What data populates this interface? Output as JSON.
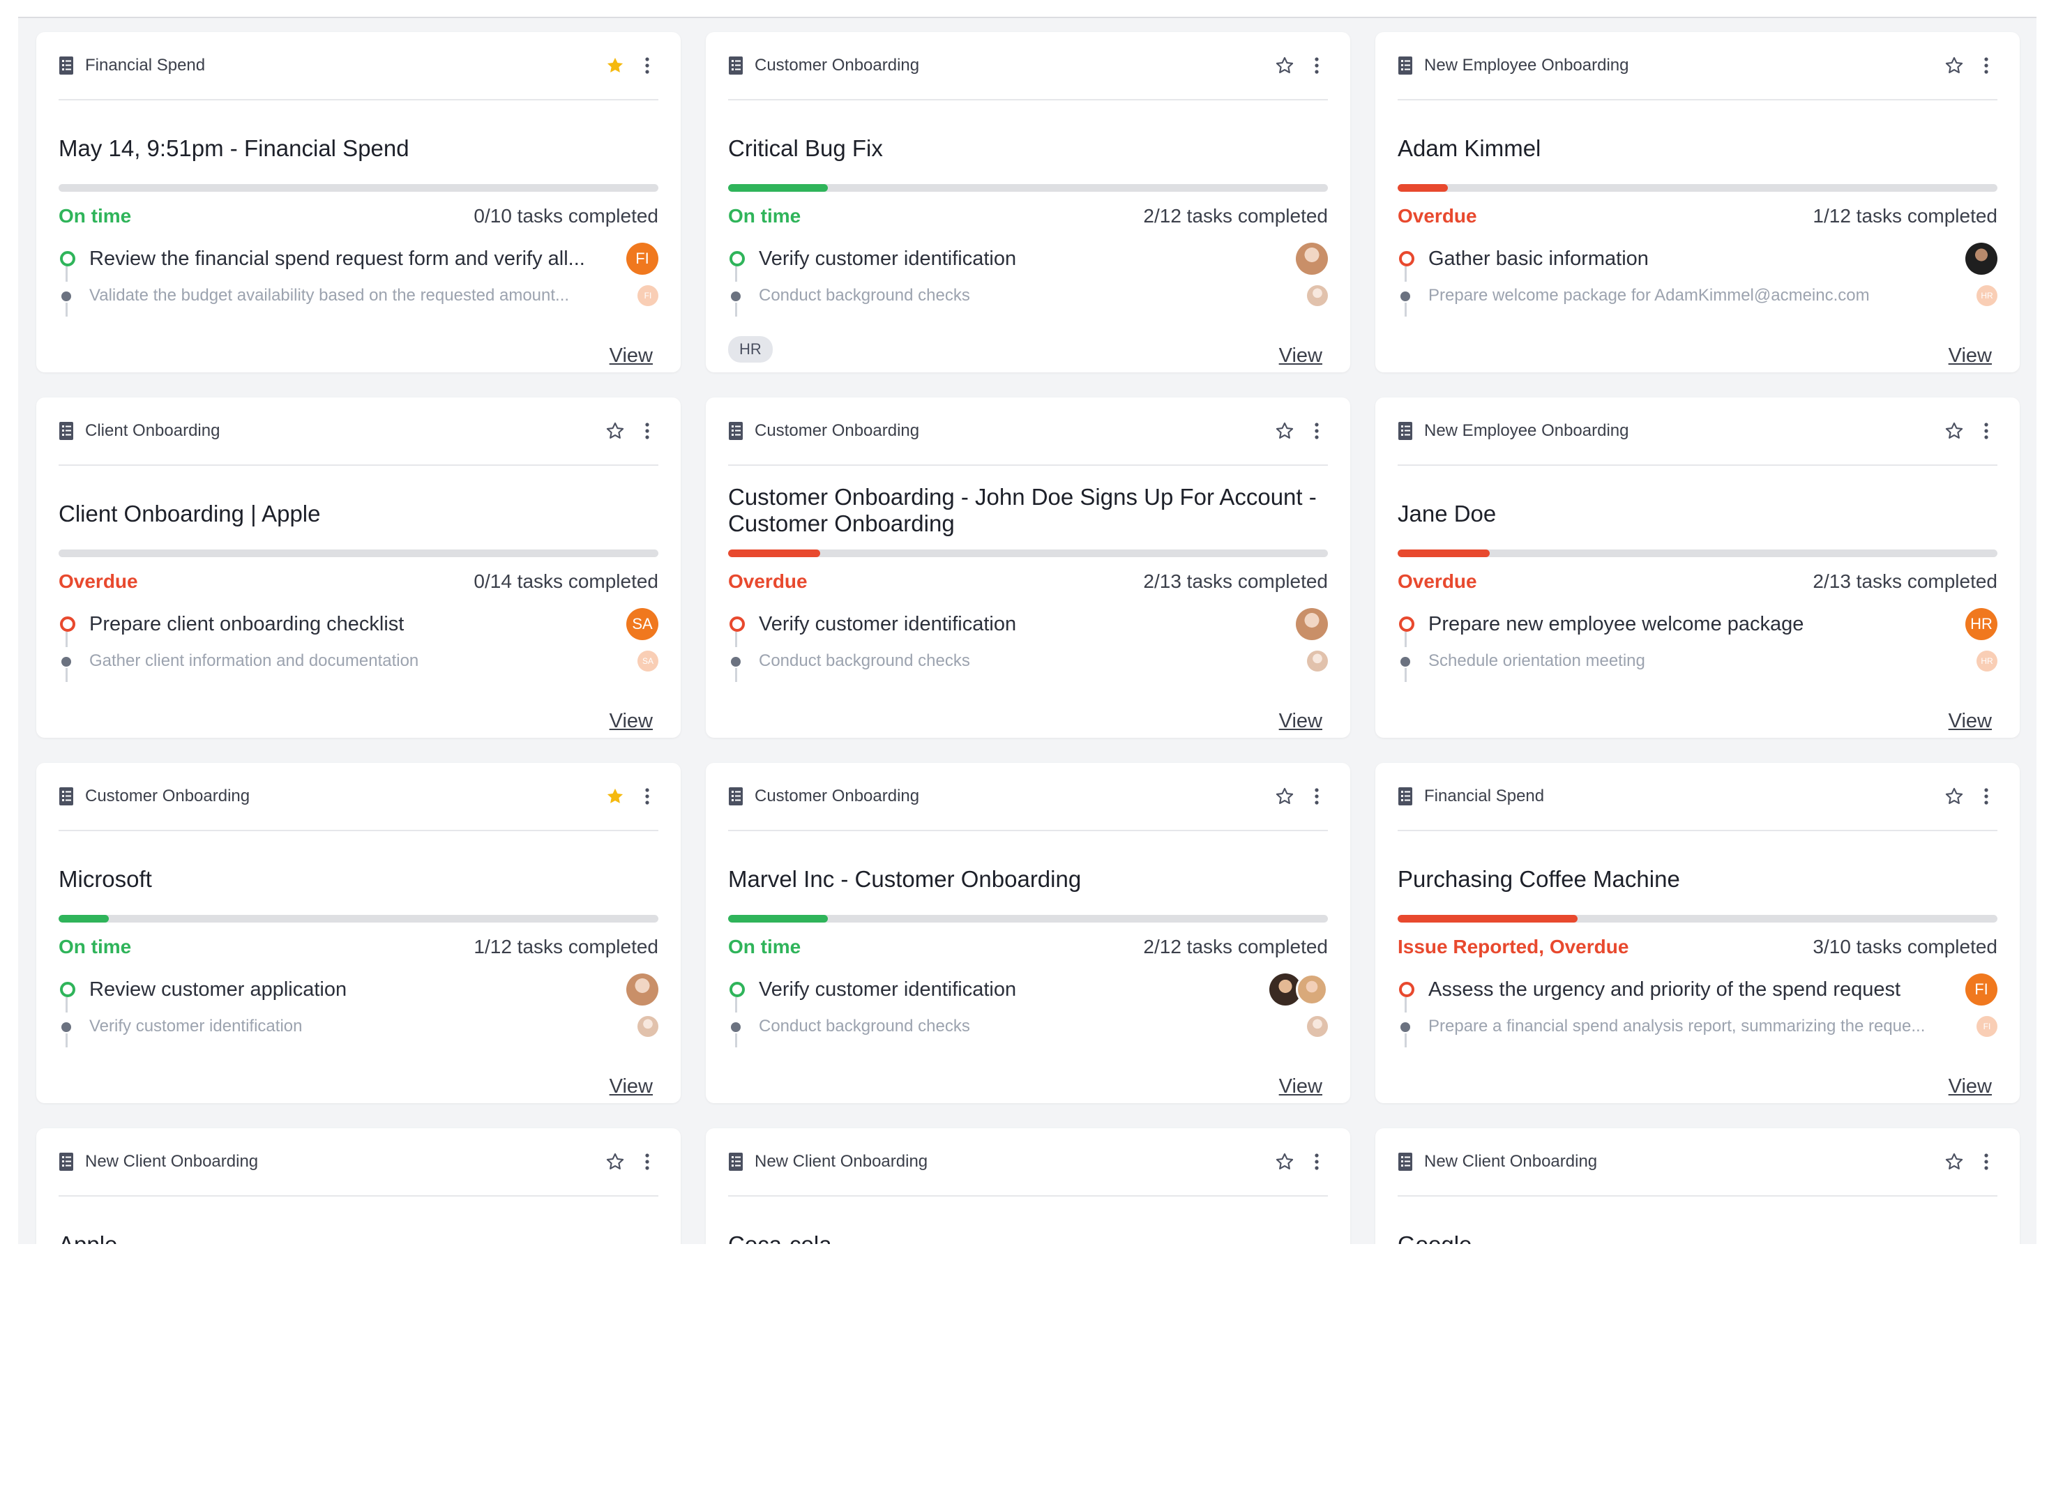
{
  "cards": [
    {
      "template": "Financial Spend",
      "title": "May 14, 9:51pm - Financial Spend",
      "starred": true,
      "progress": 0,
      "status": "On time",
      "status_color": "#2fb45a",
      "bar_color": "#2fb45a",
      "count": "0/10 tasks completed",
      "task1": "Review the financial spend request form and verify all...",
      "task2": "Validate the budget availability based on the requested amount...",
      "av1": "FI",
      "av1_color": "#f0781e",
      "av2": "FI",
      "av2_color": "#f5a77a",
      "view": "View"
    },
    {
      "template": "Customer Onboarding",
      "title": "Critical Bug Fix",
      "starred": false,
      "progress": 0.1667,
      "status": "On time",
      "status_color": "#2fb45a",
      "bar_color": "#2fb45a",
      "count": "2/12 tasks completed",
      "task1": "Verify customer identification",
      "task2": "Conduct background checks",
      "av1": "",
      "av1_kind": "photo",
      "av2": "",
      "av2_kind": "photo",
      "tag": "HR",
      "view": "View"
    },
    {
      "template": "New Employee Onboarding",
      "title": "Adam Kimmel",
      "starred": false,
      "progress": 0.0833,
      "status": "Overdue",
      "status_color": "#e8492e",
      "bar_color": "#e8492e",
      "count": "1/12 tasks completed",
      "task1": "Gather basic information",
      "task2": "Prepare welcome package for AdamKimmel@acmeinc.com",
      "av1": "",
      "av1_kind": "dark",
      "av2": "HR",
      "av2_color": "#f5a77a",
      "view": "View"
    },
    {
      "template": "Client Onboarding",
      "title": "Client Onboarding | Apple",
      "starred": false,
      "progress": 0,
      "status": "Overdue",
      "status_color": "#e8492e",
      "bar_color": "#e8492e",
      "count": "0/14 tasks completed",
      "task1": "Prepare client onboarding checklist",
      "task2": "Gather client information and documentation",
      "av1": "SA",
      "av1_color": "#f0781e",
      "av2": "SA",
      "av2_color": "#f5a77a",
      "view": "View"
    },
    {
      "template": "Customer Onboarding",
      "title": "Customer Onboarding - John Doe Signs Up For Account - Customer Onboarding",
      "starred": false,
      "progress": 0.1538,
      "status": "Overdue",
      "status_color": "#e8492e",
      "bar_color": "#e8492e",
      "count": "2/13 tasks completed",
      "task1": "Verify customer identification",
      "task2": "Conduct background checks",
      "av1": "",
      "av1_kind": "photo",
      "av2": "",
      "av2_kind": "photo",
      "view": "View"
    },
    {
      "template": "New Employee Onboarding",
      "title": "Jane Doe",
      "starred": false,
      "progress": 0.1538,
      "status": "Overdue",
      "status_color": "#e8492e",
      "bar_color": "#e8492e",
      "count": "2/13 tasks completed",
      "task1": "Prepare new employee welcome package",
      "task2": "Schedule orientation meeting",
      "av1": "HR",
      "av1_color": "#f0781e",
      "av2": "HR",
      "av2_color": "#f5a77a",
      "view": "View"
    },
    {
      "template": "Customer Onboarding",
      "title": "Microsoft",
      "starred": true,
      "progress": 0.0833,
      "status": "On time",
      "status_color": "#2fb45a",
      "bar_color": "#2fb45a",
      "count": "1/12 tasks completed",
      "task1": "Review customer application",
      "task2": "Verify customer identification",
      "av1": "",
      "av1_kind": "photo",
      "av2": "",
      "av2_kind": "photo",
      "view": "View"
    },
    {
      "template": "Customer Onboarding",
      "title": "Marvel Inc - Customer Onboarding",
      "starred": false,
      "progress": 0.1667,
      "status": "On time",
      "status_color": "#2fb45a",
      "bar_color": "#2fb45a",
      "count": "2/12 tasks completed",
      "task1": "Verify customer identification",
      "task2": "Conduct background checks",
      "av1": "",
      "av1_kind": "pair",
      "av2": "",
      "av2_kind": "photo",
      "view": "View"
    },
    {
      "template": "Financial Spend",
      "title": "Purchasing Coffee Machine",
      "starred": false,
      "progress": 0.3,
      "status": "Issue Reported, Overdue",
      "status_color": "#e8492e",
      "bar_color": "#e8492e",
      "count": "3/10 tasks completed",
      "task1": "Assess the urgency and priority of the spend request",
      "task2": "Prepare a financial spend analysis report, summarizing the reque...",
      "av1": "FI",
      "av1_color": "#f0781e",
      "av2": "FI",
      "av2_color": "#f5a77a",
      "view": "View"
    },
    {
      "template": "New Client Onboarding",
      "title": "Apple",
      "starred": false,
      "partial": true
    },
    {
      "template": "New Client Onboarding",
      "title": "Coca-cola",
      "starred": false,
      "partial": true
    },
    {
      "template": "New Client Onboarding",
      "title": "Google.",
      "starred": false,
      "partial": true
    }
  ],
  "colors": {
    "green": "#2fb45a",
    "red": "#e8492e",
    "star": "#f5b90f",
    "track": "#dedfe2"
  }
}
